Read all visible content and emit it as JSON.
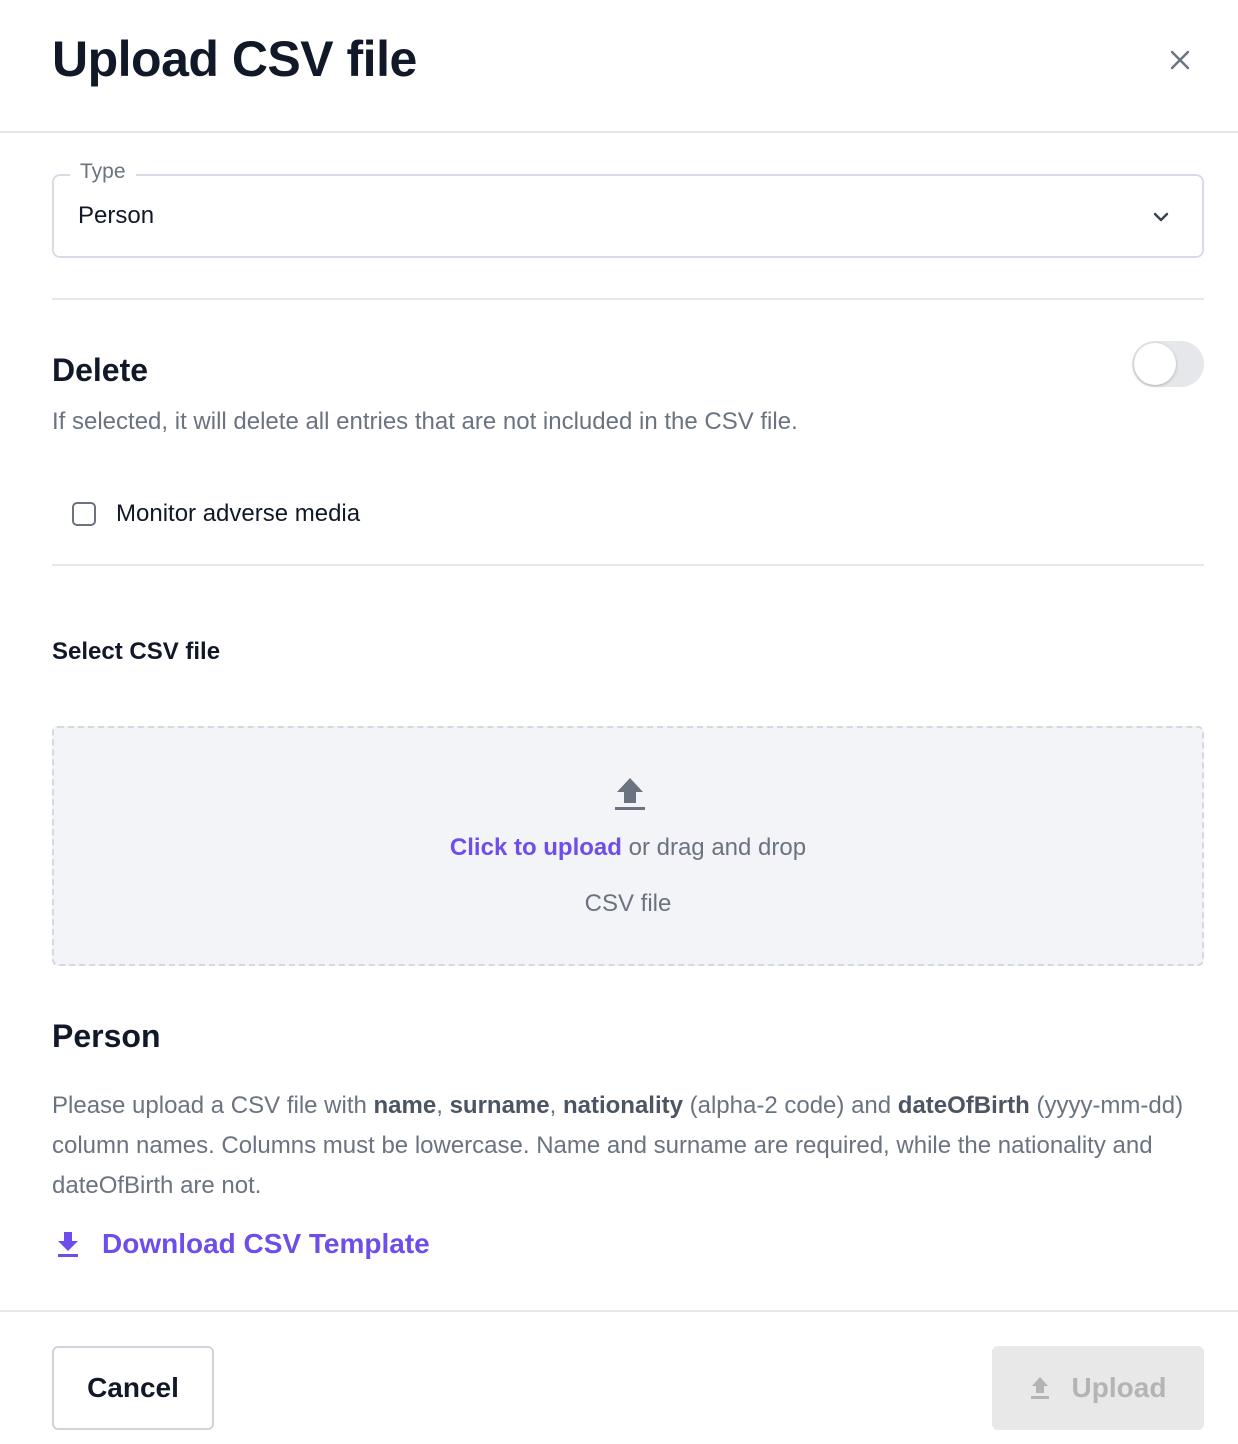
{
  "dialog": {
    "title": "Upload CSV file",
    "close_icon": "close-icon"
  },
  "type_select": {
    "legend": "Type",
    "value": "Person",
    "icon": "chevron-down-icon"
  },
  "delete_section": {
    "title": "Delete",
    "description": "If selected, it will delete all entries that are not included in the CSV file.",
    "toggle_on": false
  },
  "monitor_checkbox": {
    "label": "Monitor adverse media",
    "checked": false
  },
  "file_section": {
    "label": "Select CSV file",
    "dropzone": {
      "icon": "upload-icon",
      "link_text": "Click to upload",
      "rest_text": "or drag and drop",
      "hint": "CSV file"
    }
  },
  "person_section": {
    "title": "Person",
    "desc_intro": "Please upload a CSV file with ",
    "field_name": "name",
    "sep1": ", ",
    "field_surname": "surname",
    "sep2": ", ",
    "field_nationality": "nationality",
    "nationality_note": " (alpha-2 code) and ",
    "field_dob": "dateOfBirth",
    "desc_outro": " (yyyy-mm-dd) column names. Columns must be lowercase. Name and surname are required, while the nationality and dateOfBirth are not.",
    "download_label": "Download CSV Template",
    "download_icon": "download-icon"
  },
  "footer": {
    "cancel_label": "Cancel",
    "upload_label": "Upload",
    "upload_icon": "upload-icon"
  },
  "colors": {
    "accent": "#6d4eea",
    "muted_text": "#6b7280",
    "border": "#e5e7eb",
    "dropzone_bg": "#f3f4f7",
    "disabled_bg": "#e8e8e8"
  }
}
